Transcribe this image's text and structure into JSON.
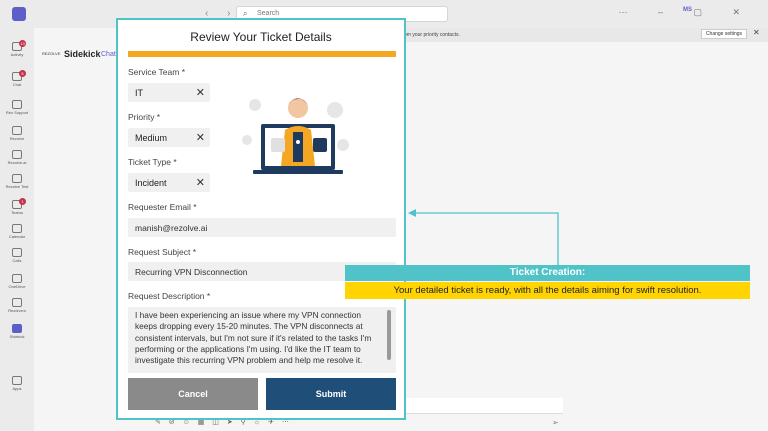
{
  "search": {
    "placeholder": "Search"
  },
  "user": {
    "initials": "MS"
  },
  "notice": {
    "text": "om your priority contacts.",
    "change_button": "Change settings"
  },
  "rail": [
    {
      "label": "Activity",
      "badge": "13"
    },
    {
      "label": "Chat",
      "badge": "5"
    },
    {
      "label": "Rez Support",
      "badge": ""
    },
    {
      "label": "Rezolve",
      "badge": ""
    },
    {
      "label": "Rezolve.ai",
      "badge": ""
    },
    {
      "label": "Rezolve Test",
      "badge": ""
    },
    {
      "label": "Teams",
      "badge": "1"
    },
    {
      "label": "Calendar",
      "badge": ""
    },
    {
      "label": "Calls",
      "badge": ""
    },
    {
      "label": "OneDrive",
      "badge": ""
    },
    {
      "label": "Rezolvers",
      "badge": ""
    },
    {
      "label": "Sidekick",
      "badge": ""
    },
    {
      "label": "Apps",
      "badge": ""
    }
  ],
  "chat": {
    "brand_tag": "REZOLVE",
    "title": "Sidekick",
    "tab": "Chat"
  },
  "modal": {
    "title": "Review Your Ticket Details",
    "service_team": {
      "label": "Service Team *",
      "value": "IT"
    },
    "priority": {
      "label": "Priority *",
      "value": "Medium"
    },
    "ticket_type": {
      "label": "Ticket Type *",
      "value": "Incident"
    },
    "requester_email": {
      "label": "Requester Email *",
      "value": "manish@rezolve.ai"
    },
    "request_subject": {
      "label": "Request Subject *",
      "value": "Recurring VPN Disconnection"
    },
    "request_description": {
      "label": "Request Description *",
      "value": "I have been experiencing an issue where my VPN connection keeps dropping every 15-20 minutes. The VPN disconnects at consistent intervals, but I'm not sure if it's related to the tasks I'm performing or the applications I'm using. I'd like the IT team to investigate this recurring VPN problem and help me resolve it."
    },
    "cancel_label": "Cancel",
    "submit_label": "Submit"
  },
  "callout": {
    "title": "Ticket Creation:",
    "body": "Your detailed ticket is ready, with all the details aiming for swift resolution."
  },
  "colors": {
    "accent_teal": "#4fc3c8",
    "accent_orange": "#f5a623",
    "submit_navy": "#1f4e79",
    "cancel_gray": "#8a8a8a",
    "highlight_yellow": "#ffd400",
    "teams_purple": "#5b5fc7"
  }
}
